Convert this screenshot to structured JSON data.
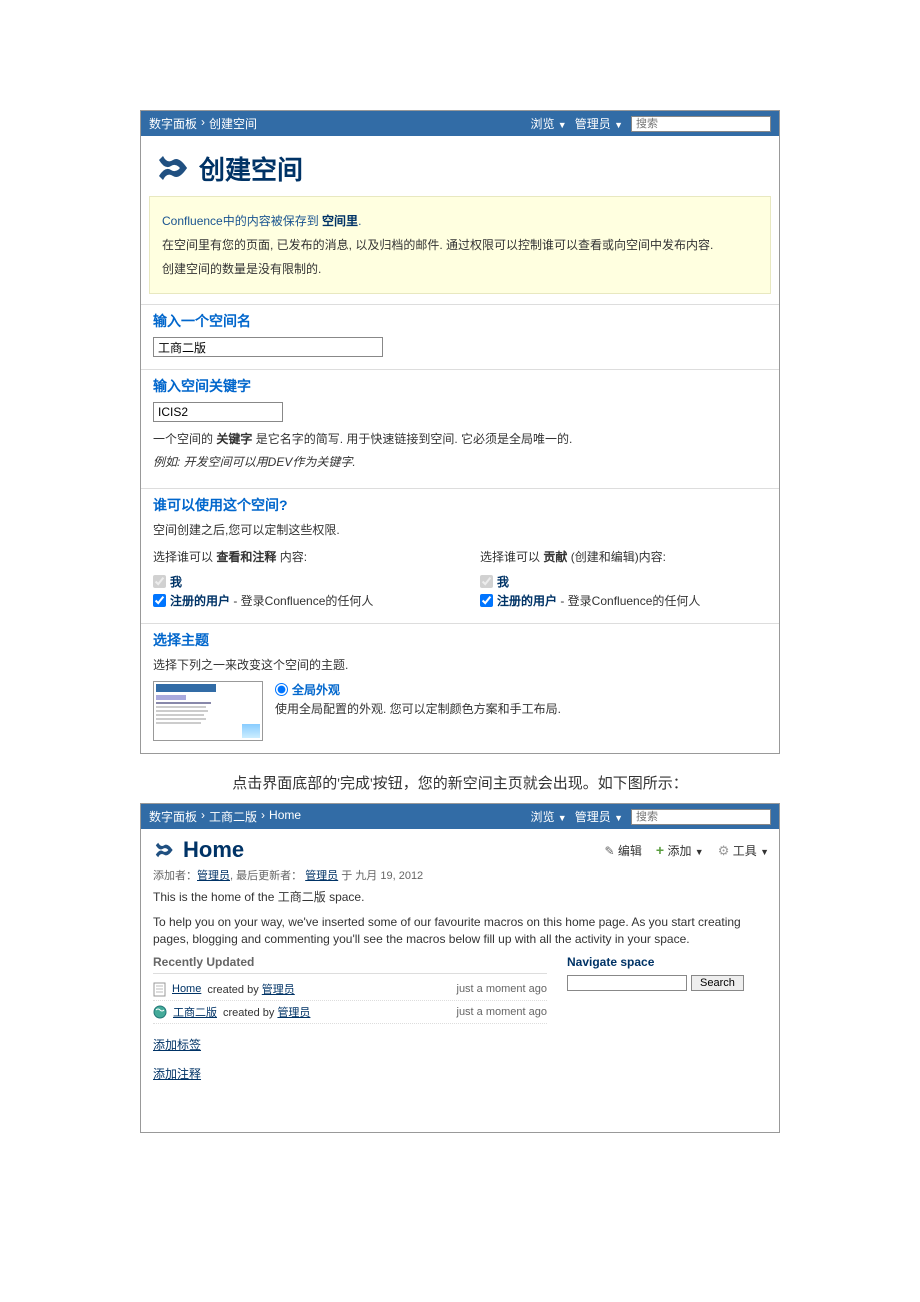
{
  "nav1": {
    "crumb": [
      "数字面板",
      "›",
      "创建空间"
    ],
    "browse": "浏览",
    "admin": "管理员",
    "search_placeholder": "搜索"
  },
  "create_space": {
    "title": "创建空间",
    "intro_line1_a": "Confluence中的内容被保存到 ",
    "intro_line1_b": "空间里",
    "intro_line1_c": ".",
    "intro_line2": "在空间里有您的页面, 已发布的消息, 以及归档的邮件. 通过权限可以控制谁可以查看或向空间中发布内容.",
    "intro_line3": "创建空间的数量是没有限制的.",
    "name_heading": "输入一个空间名",
    "name_value": "工商二版",
    "key_heading": "输入空间关键字",
    "key_value": "ICIS2",
    "key_help_a": "一个空间的 ",
    "key_help_b": "关键字",
    "key_help_c": " 是它名字的简写. 用于快速链接到空间. 它必须是全局唯一的.",
    "key_hint": "例如: 开发空间可以用DEV作为关键字.",
    "perm_heading": "谁可以使用这个空间?",
    "perm_sub": "空间创建之后,您可以定制这些权限.",
    "perm_view_label_a": "选择谁可以 ",
    "perm_view_label_b": "查看和注释",
    "perm_view_label_c": " 内容:",
    "perm_contrib_label_a": "选择谁可以 ",
    "perm_contrib_label_b": "贡献",
    "perm_contrib_label_c": " (创建和编辑)内容:",
    "perm_me": "我",
    "perm_reg_a": "注册的用户",
    "perm_reg_b": " - 登录Confluence的任何人",
    "theme_heading": "选择主题",
    "theme_sub": "选择下列之一来改变这个空间的主题.",
    "theme_name": "全局外观",
    "theme_desc": "使用全局配置的外观. 您可以定制颜色方案和手工布局."
  },
  "mid_caption": "点击界面底部的'完成'按钮，您的新空间主页就会出现。如下图所示：",
  "nav2": {
    "crumb": [
      "数字面板",
      "›",
      "工商二版",
      "›",
      "Home"
    ],
    "browse": "浏览",
    "admin": "管理员",
    "search_placeholder": "搜索"
  },
  "home": {
    "title": "Home",
    "edit": "编辑",
    "add": "添加",
    "tools": "工具",
    "meta_a": "添加者：",
    "meta_admin": "管理员",
    "meta_b": ", 最后更新者：",
    "meta_c": " 于 九月 19, 2012",
    "intro": "This is the home of the 工商二版 space.",
    "help": "To help you on your way, we've inserted some of our favourite macros on this home page. As you start creating pages, blogging and commenting you'll see the macros below fill up with all the activity in your space.",
    "recent_title": "Recently Updated",
    "recent1_name": "Home",
    "recent1_by": "created by",
    "recent1_user": "管理员",
    "recent1_time": "just a moment ago",
    "recent2_name": "工商二版",
    "recent2_by": "created by",
    "recent2_user": "管理员",
    "recent2_time": "just a moment ago",
    "nav_title": "Navigate space",
    "search_btn": "Search",
    "add_label": "添加标签",
    "add_comment": "添加注释"
  }
}
